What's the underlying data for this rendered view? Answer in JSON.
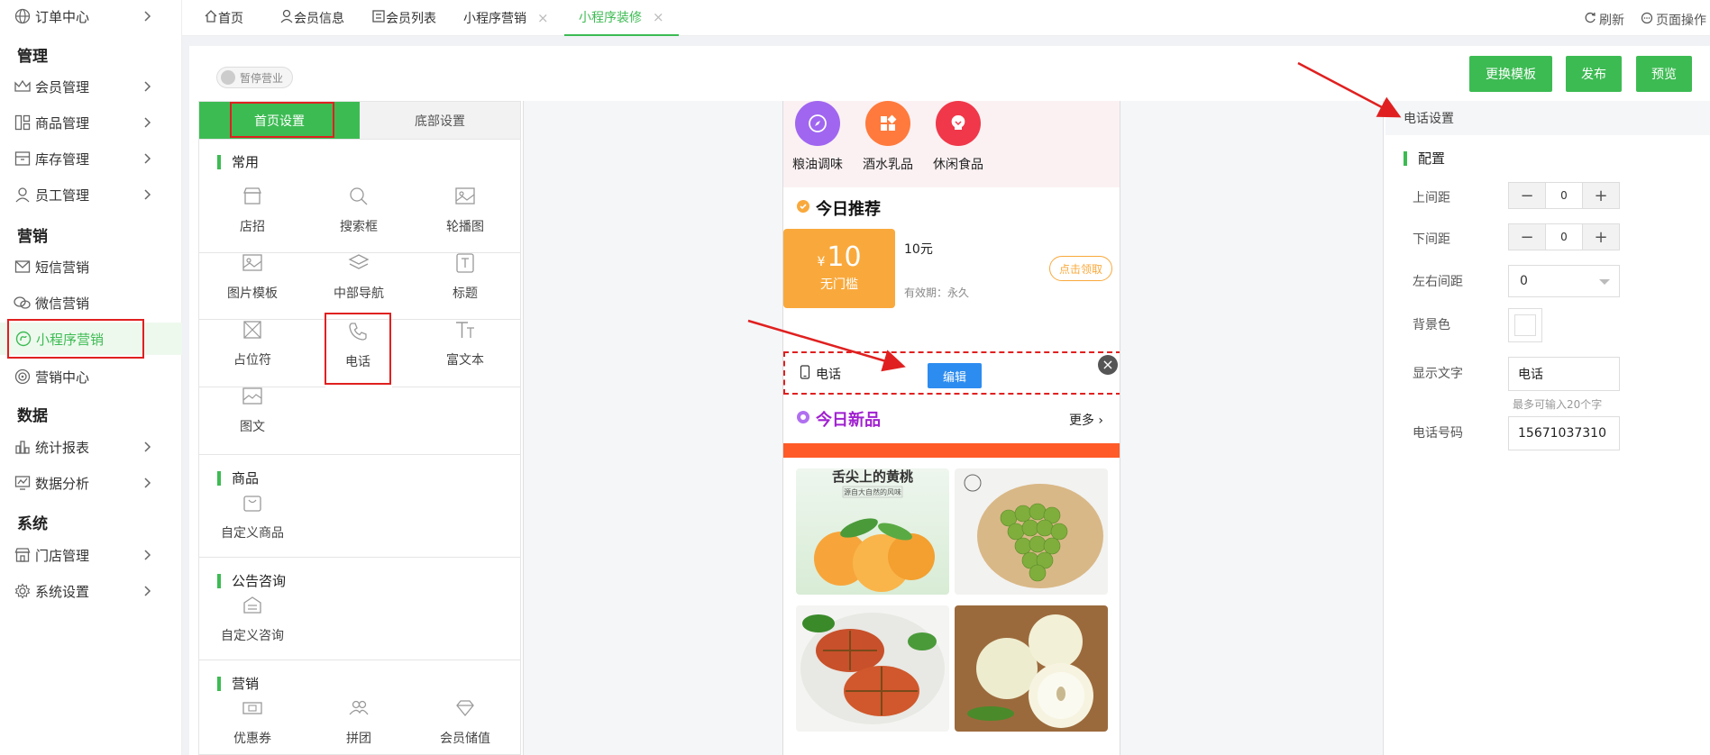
{
  "nav": {
    "sections": [
      {
        "label": "管理"
      },
      {
        "label": "营销"
      },
      {
        "label": "数据"
      },
      {
        "label": "系统"
      }
    ],
    "items": [
      {
        "label": "订单中心",
        "icon": "globe-icon"
      },
      {
        "label": "会员管理",
        "icon": "crown-icon"
      },
      {
        "label": "商品管理",
        "icon": "grid-icon"
      },
      {
        "label": "库存管理",
        "icon": "box-icon"
      },
      {
        "label": "员工管理",
        "icon": "user-icon"
      },
      {
        "label": "短信营销",
        "icon": "mail-icon"
      },
      {
        "label": "微信营销",
        "icon": "chat-icon"
      },
      {
        "label": "小程序营销",
        "icon": "miniapp-icon"
      },
      {
        "label": "营销中心",
        "icon": "target-icon"
      },
      {
        "label": "统计报表",
        "icon": "bar-chart-icon"
      },
      {
        "label": "数据分析",
        "icon": "line-chart-icon"
      },
      {
        "label": "门店管理",
        "icon": "store-icon"
      },
      {
        "label": "系统设置",
        "icon": "gear-icon"
      }
    ]
  },
  "tabs": [
    {
      "label": "首页"
    },
    {
      "label": "会员信息"
    },
    {
      "label": "会员列表"
    },
    {
      "label": "小程序营销"
    },
    {
      "label": "小程序装修"
    }
  ],
  "tab_actions": {
    "refresh": "刷新",
    "page_ops": "页面操作"
  },
  "toolbar": {
    "status": "暂停营业",
    "change_template": "更换模板",
    "publish": "发布",
    "preview": "预览"
  },
  "picker": {
    "tabs": [
      "首页设置",
      "底部设置"
    ],
    "groups": [
      {
        "title": "常用",
        "items": [
          "店招",
          "搜索框",
          "轮播图",
          "图片模板",
          "中部导航",
          "标题",
          "占位符",
          "电话",
          "富文本",
          "图文"
        ]
      },
      {
        "title": "商品",
        "items": [
          "自定义商品"
        ]
      },
      {
        "title": "公告咨询",
        "items": [
          "自定义咨询"
        ]
      },
      {
        "title": "营销",
        "items": [
          "优惠券",
          "拼团",
          "会员储值"
        ]
      }
    ]
  },
  "phone": {
    "categories": [
      {
        "label": "粮油调味",
        "color": "#a066f0"
      },
      {
        "label": "酒水乳品",
        "color": "#ff7a3c"
      },
      {
        "label": "休闲食品",
        "color": "#f0384a"
      }
    ],
    "today_recommend": "今日推荐",
    "coupon": {
      "currency": "¥",
      "amount": "10",
      "condition": "无门槛",
      "name": "10元",
      "validity": "有效期：永久",
      "get": "点击领取"
    },
    "phone_row": {
      "label": "电话",
      "edit": "编辑",
      "close": "×"
    },
    "new_today": "今日新品",
    "more": "更多",
    "banner_text": "舌尖上的黄桃",
    "banner_sub": "源自大自然的风味"
  },
  "settings": {
    "header": "电话设置",
    "config": "配置",
    "top_margin": {
      "label": "上间距",
      "value": "0"
    },
    "bottom_margin": {
      "label": "下间距",
      "value": "0"
    },
    "lr_margin": {
      "label": "左右间距",
      "value": "0"
    },
    "bg_color": {
      "label": "背景色"
    },
    "display_text": {
      "label": "显示文字",
      "value": "电话",
      "hint": "最多可输入20个字"
    },
    "phone_number": {
      "label": "电话号码",
      "value": "15671037310"
    }
  },
  "colors": {
    "brand": "#3dbb53",
    "highlight": "#e02020",
    "edit_blue": "#2d8cf0",
    "coupon": "#f9a93c"
  }
}
